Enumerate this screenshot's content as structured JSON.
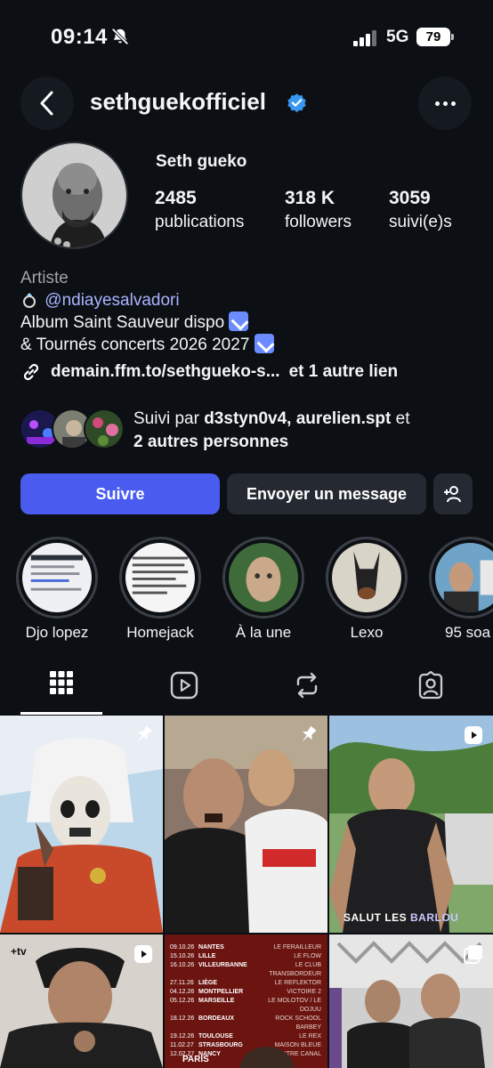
{
  "status_bar": {
    "time": "09:14",
    "network": "5G",
    "battery": "79"
  },
  "header": {
    "username": "sethguekofficiel"
  },
  "profile": {
    "display_name": "Seth gueko",
    "stats": [
      {
        "value": "2485",
        "label": "publications"
      },
      {
        "value": "318 K",
        "label": "followers"
      },
      {
        "value": "3059",
        "label": "suivi(e)s"
      }
    ],
    "category": "Artiste",
    "mention": "@ndiayesalvadori",
    "bio_line1": "Album Saint Sauveur dispo",
    "bio_line2": "& Tournés concerts 2026 2027",
    "link": "demain.ffm.to/sethgueko-s...",
    "link_extra": "et 1 autre lien",
    "followed_by_prefix": "Suivi par",
    "followed_by_names": "d3styn0v4, aurelien.spt",
    "followed_by_and": "et",
    "followed_by_more": "2 autres personnes"
  },
  "actions": {
    "follow_label": "Suivre",
    "message_label": "Envoyer un message"
  },
  "highlights": [
    {
      "label": "Djo lopez"
    },
    {
      "label": "Homejack"
    },
    {
      "label": "À la une"
    },
    {
      "label": "Lexo"
    },
    {
      "label": "95 soa"
    }
  ],
  "posts": {
    "overlay_caption_word1": "SALUT LES",
    "overlay_caption_word2": "BARLOU",
    "tv_badge": "+tv",
    "tour_dates": [
      {
        "date": "09.10.26",
        "city": "NANTES",
        "venue": "LE FERAILLEUR"
      },
      {
        "date": "15.10.26",
        "city": "LILLE",
        "venue": "LE FLOW"
      },
      {
        "date": "16.10.26",
        "city": "VILLEURBANNE",
        "venue": "LE CLUB TRANSBORDEUR"
      },
      {
        "date": "27.11.26",
        "city": "LIÈGE",
        "venue": "LE REFLEKTOR"
      },
      {
        "date": "04.12.26",
        "city": "MONTPELLIER",
        "venue": "VICTOIRE 2"
      },
      {
        "date": "05.12.26",
        "city": "MARSEILLE",
        "venue": "LE MOLOTOV / LE DOJUU"
      },
      {
        "date": "18.12.26",
        "city": "BORDEAUX",
        "venue": "ROCK SCHOOL BARBEY"
      },
      {
        "date": "19.12.26",
        "city": "TOULOUSE",
        "venue": "LE REX"
      },
      {
        "date": "11.02.27",
        "city": "STRASBOURG",
        "venue": "MAISON BLEUE"
      },
      {
        "date": "12.02.27",
        "city": "NANCY",
        "venue": "L'AUTRE CANAL"
      }
    ],
    "tour_footer": "PARIS"
  },
  "colors": {
    "background": "#0c0f14",
    "accent": "#4a5cf0",
    "mention": "#aab4ff",
    "button_dark": "#252a32"
  }
}
